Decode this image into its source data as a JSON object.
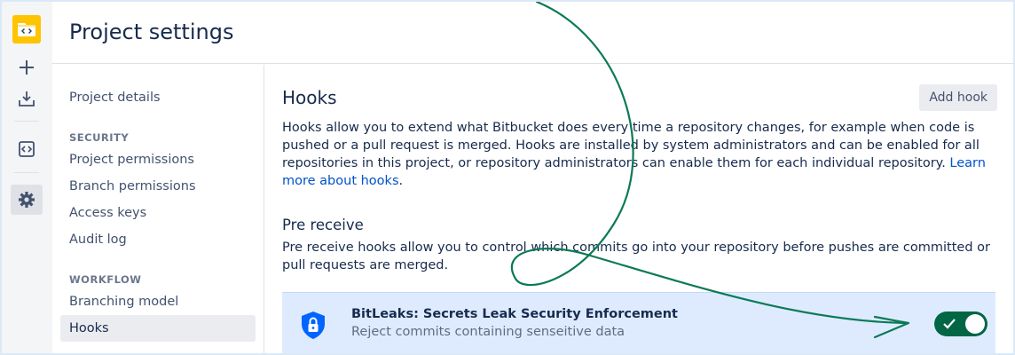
{
  "header": {
    "title": "Project settings"
  },
  "rail": {
    "items": [
      {
        "icon": "project-code-icon"
      },
      {
        "icon": "plus-icon"
      },
      {
        "icon": "download-icon"
      },
      {
        "icon": "code-icon"
      },
      {
        "icon": "gear-icon",
        "active": true
      }
    ]
  },
  "nav": {
    "project_details": "Project details",
    "security_heading": "SECURITY",
    "project_permissions": "Project permissions",
    "branch_permissions": "Branch permissions",
    "access_keys": "Access keys",
    "audit_log": "Audit log",
    "workflow_heading": "WORKFLOW",
    "branching_model": "Branching model",
    "hooks": "Hooks",
    "selected": "Hooks"
  },
  "main": {
    "title": "Hooks",
    "add_hook_label": "Add hook",
    "description": "Hooks allow you to extend what Bitbucket does every time a repository changes, for example when code is pushed or a pull request is merged. Hooks are installed by system administrators and can be enabled for all repositories in this project, or repository administrators can enable them for each individual repository.",
    "learn_more_link": "Learn more about hooks",
    "pre_receive": {
      "title": "Pre receive",
      "description": "Pre receive hooks allow you to control which commits go into your repository before pushes are committed or pull requests are merged.",
      "hooks": [
        {
          "name": "BitLeaks: Secrets Leak Security Enforcement",
          "description": "Reject commits containing senseitive data",
          "enabled": true,
          "icon": "shield-lock-icon"
        }
      ]
    }
  },
  "colors": {
    "toggle_on": "#006644",
    "highlight_row": "#deebff",
    "annotation_arrow": "#0b7a55",
    "link": "#0052cc",
    "brand_icon": "#ffc400"
  }
}
